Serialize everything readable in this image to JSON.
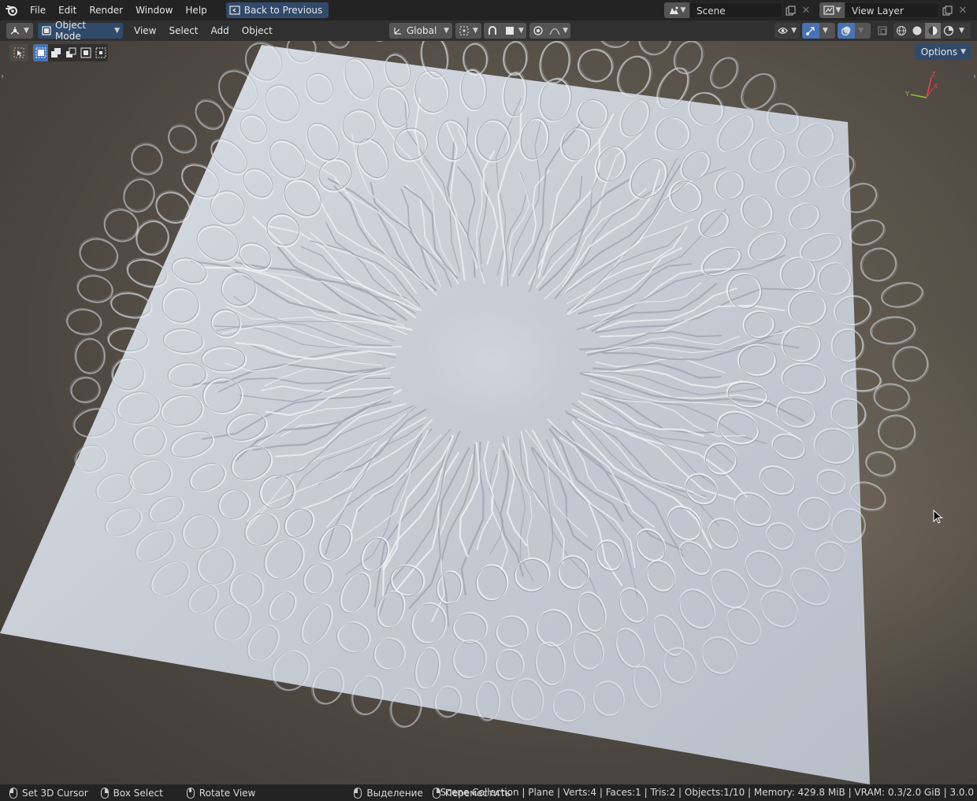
{
  "topbar": {
    "menu": [
      "File",
      "Edit",
      "Render",
      "Window",
      "Help"
    ],
    "back_label": "Back to Previous",
    "scene_name": "Scene",
    "view_layer": "View Layer"
  },
  "header": {
    "mode": "Object Mode",
    "menus": [
      "View",
      "Select",
      "Add",
      "Object"
    ],
    "orientation": "Global"
  },
  "viewport": {
    "options_label": "Options",
    "gizmo_axes": {
      "x": "X",
      "y": "Y",
      "z": "Z"
    }
  },
  "statusbar": {
    "items": [
      "Set 3D Cursor",
      "Box Select",
      "Rotate View",
      "Выделение",
      "Переместить"
    ],
    "stats": "Scene Collection | Plane | Verts:4 | Faces:1 | Tris:2 | Objects:1/10 | Memory: 429.8 MiB | VRAM: 0.3/2.0 GiB | 3.0.0"
  },
  "colors": {
    "accent": "#314a6b",
    "active": "#4772b3",
    "plane": "#c9d0d8"
  }
}
